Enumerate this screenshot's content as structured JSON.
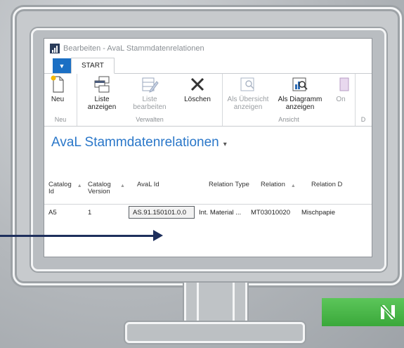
{
  "window": {
    "title": "Bearbeiten - AvaL Stammdatenrelationen"
  },
  "tabs": {
    "start": "START"
  },
  "ribbon": {
    "groups": [
      {
        "label": "Neu",
        "buttons": [
          {
            "label": "Neu",
            "icon": "new-document-icon",
            "disabled": false
          }
        ]
      },
      {
        "label": "Verwalten",
        "buttons": [
          {
            "label": "Liste anzeigen",
            "icon": "list-view-icon",
            "disabled": false
          },
          {
            "label": "Liste bearbeiten",
            "icon": "list-edit-icon",
            "disabled": true
          },
          {
            "label": "Löschen",
            "icon": "delete-x-icon",
            "disabled": false
          }
        ]
      },
      {
        "label": "Ansicht",
        "buttons": [
          {
            "label": "Als Übersicht anzeigen",
            "icon": "overview-icon",
            "disabled": true
          },
          {
            "label": "Als Diagramm anzeigen",
            "icon": "chart-icon",
            "disabled": false
          },
          {
            "label": "On",
            "icon": "onenote-icon",
            "disabled": true
          }
        ]
      },
      {
        "label": "D",
        "buttons": []
      }
    ]
  },
  "page": {
    "title": "AvaL Stammdatenrelationen"
  },
  "grid": {
    "headers": [
      "Catalog Id",
      "Catalog Version",
      "AvaL Id",
      "Relation Type",
      "Relation",
      "Relation D"
    ],
    "rows": [
      [
        "A5",
        "1",
        "AS.91.150101.0.0",
        "Int. Material ...",
        "MT03010020",
        "Mischpapie"
      ]
    ]
  },
  "colors": {
    "accent": "#2a77c9",
    "file_tab": "#1b6fc4",
    "arrow": "#1e2f5c",
    "logo_green": "#4cb94a"
  }
}
